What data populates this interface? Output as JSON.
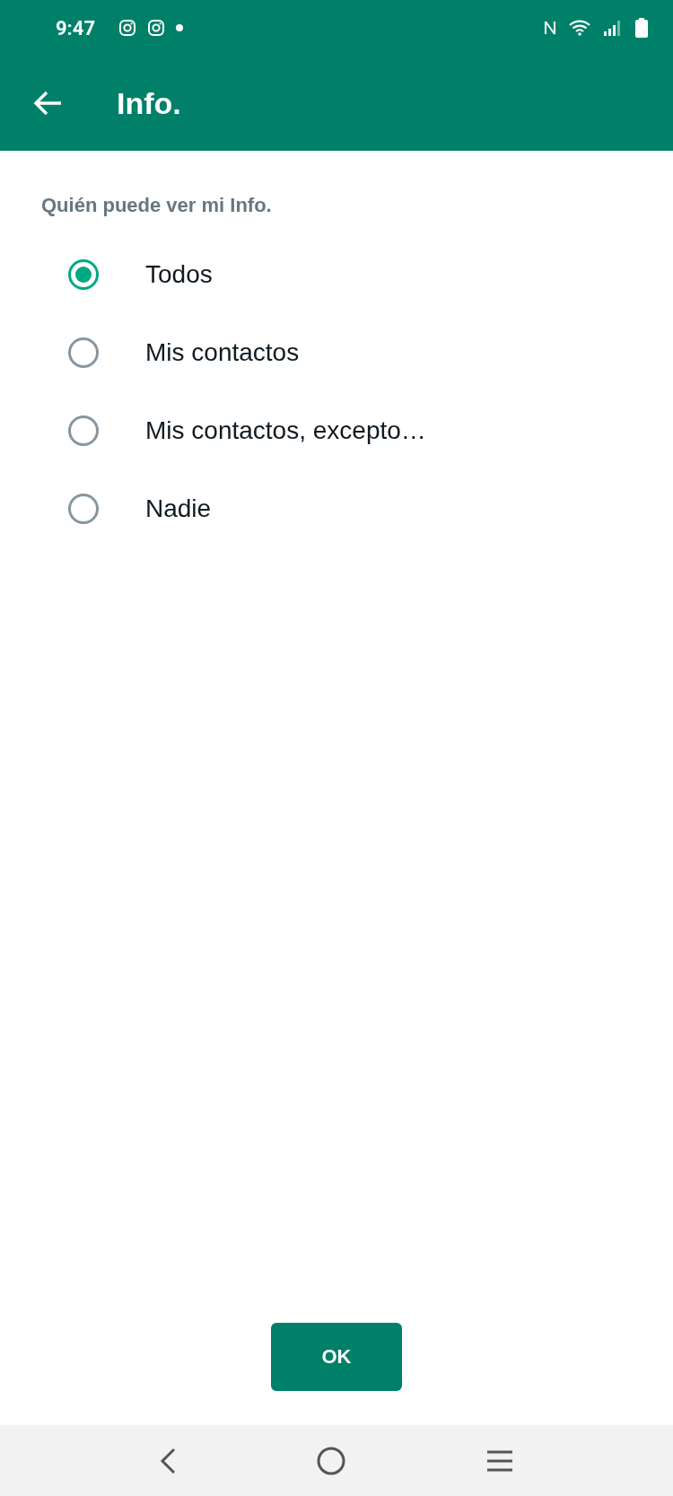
{
  "status_bar": {
    "time": "9:47"
  },
  "app_bar": {
    "title": "Info."
  },
  "section": {
    "label": "Quién puede ver mi Info."
  },
  "options": [
    {
      "label": "Todos",
      "selected": true
    },
    {
      "label": "Mis contactos",
      "selected": false
    },
    {
      "label": "Mis contactos, excepto…",
      "selected": false
    },
    {
      "label": "Nadie",
      "selected": false
    }
  ],
  "ok_button": {
    "label": "OK"
  }
}
